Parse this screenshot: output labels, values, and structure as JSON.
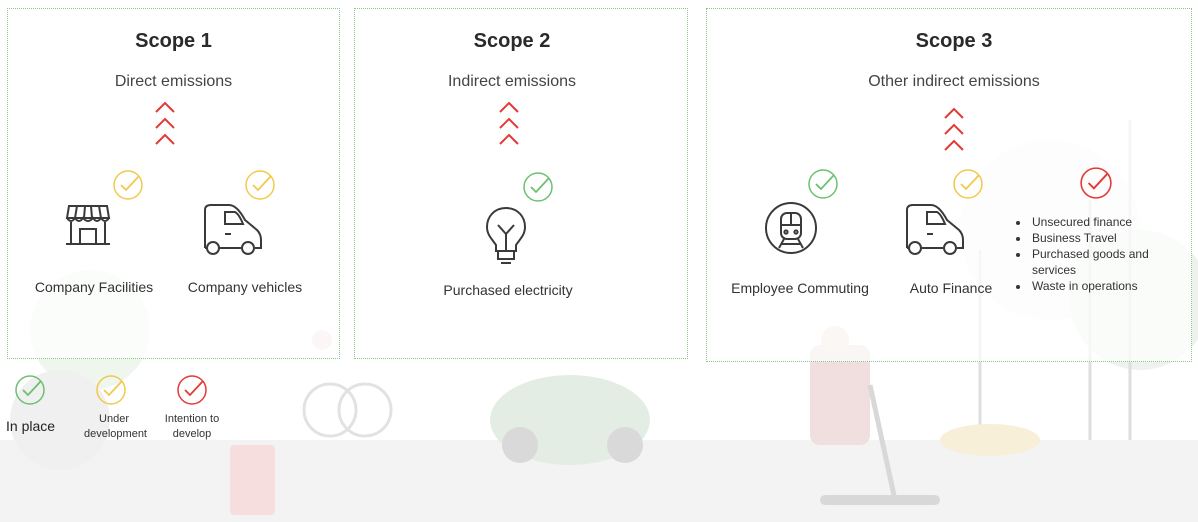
{
  "scopes": [
    {
      "title": "Scope 1",
      "subtitle": "Direct emissions",
      "items": [
        {
          "label": "Company Facilities",
          "status": "under-development",
          "icon": "storefront-icon"
        },
        {
          "label": "Company vehicles",
          "status": "under-development",
          "icon": "car-icon"
        }
      ]
    },
    {
      "title": "Scope 2",
      "subtitle": "Indirect emissions",
      "items": [
        {
          "label": "Purchased electricity",
          "status": "in-place",
          "icon": "lightbulb-icon"
        }
      ]
    },
    {
      "title": "Scope 3",
      "subtitle": "Other indirect emissions",
      "items": [
        {
          "label": "Employee Commuting",
          "status": "in-place",
          "icon": "train-icon"
        },
        {
          "label": "Auto Finance",
          "status": "under-development",
          "icon": "car-icon"
        }
      ],
      "intention_list": [
        "Unsecured finance",
        "Business Travel",
        "Purchased goods and services",
        "Waste in operations"
      ]
    }
  ],
  "legend": {
    "in_place": "In place",
    "under_development": "Under development",
    "intention": "Intention to develop"
  },
  "colors": {
    "in_place": "#6cc070",
    "under_development": "#f2c94c",
    "intention": "#e53935",
    "arrows": "#e53935",
    "border": "#8cc48c",
    "icon": "#3a3a3a"
  }
}
